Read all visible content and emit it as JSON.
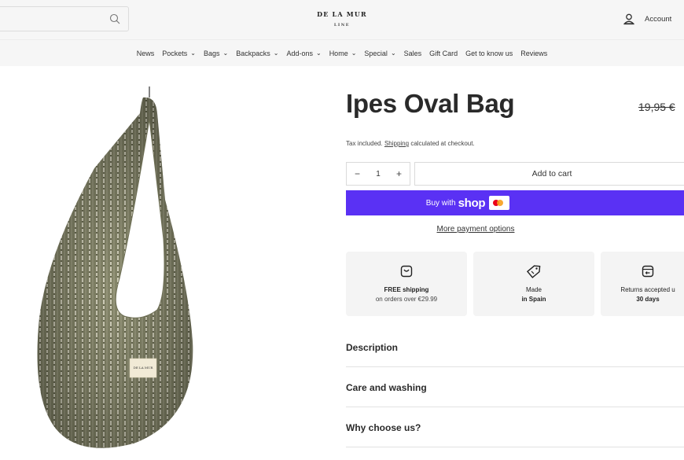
{
  "header": {
    "logo_main": "DE LA MUR",
    "logo_sub": "LINE",
    "account_label": "Account"
  },
  "nav": {
    "items": [
      {
        "label": "News",
        "dropdown": false
      },
      {
        "label": "Pockets",
        "dropdown": true
      },
      {
        "label": "Bags",
        "dropdown": true
      },
      {
        "label": "Backpacks",
        "dropdown": true
      },
      {
        "label": "Add-ons",
        "dropdown": true
      },
      {
        "label": "Home",
        "dropdown": true
      },
      {
        "label": "Special",
        "dropdown": true
      },
      {
        "label": "Sales",
        "dropdown": false
      },
      {
        "label": "Gift Card",
        "dropdown": false
      },
      {
        "label": "Get to know us",
        "dropdown": false
      },
      {
        "label": "Reviews",
        "dropdown": false
      }
    ]
  },
  "product": {
    "title": "Ipes Oval Bag",
    "price_old": "19,95 €",
    "tax_prefix": "Tax included.",
    "tax_link": "Shipping",
    "tax_suffix": "calculated at checkout.",
    "quantity": "1",
    "qty_minus": "−",
    "qty_plus": "+",
    "add_to_cart": "Add to cart",
    "buy_with": "Buy with",
    "shop_word": "shop",
    "more_payment": "More payment options",
    "bag_label": "DE LA MUR"
  },
  "features": [
    {
      "icon": "bag-icon",
      "line1": "FREE shipping",
      "line2": "on orders over €29.99"
    },
    {
      "icon": "tag-icon",
      "line1": "Made",
      "line2": "in Spain"
    },
    {
      "icon": "return-icon",
      "line1": "Returns accepted u",
      "line2": "30 days"
    }
  ],
  "accordions": [
    {
      "label": "Description"
    },
    {
      "label": "Care and washing"
    },
    {
      "label": "Why choose us?"
    }
  ],
  "colors": {
    "shop_pay": "#5a31f4",
    "bag_green": "#8a8a6a"
  }
}
